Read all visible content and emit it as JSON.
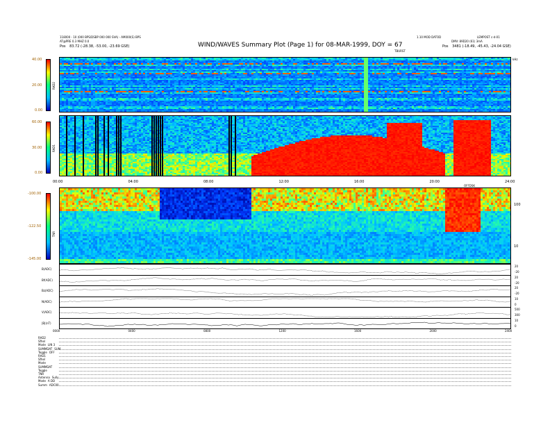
{
  "header": {
    "title": "WIND/WAVES Summary Plot (Page 1) for 08-MAR-1999, DOY = 67",
    "left_line1": "118000 - 10 (000 BPS/DSBP 000 000 SVA) - AM000(S) BPS",
    "left_line2": "AT@PRE 0.3 MHZ 0.0",
    "left_pos_label": "Pos",
    "left_pos": "83.72 (-28.38, -53.00, -23.69 GSE)",
    "right_line1": "1.10 MOD DATOD",
    "right_line2": "LEMPOST c-d-01",
    "right_line3": "DMV: 89D20 (61) 3mA",
    "right_pos_label": "Pos",
    "right_pos": "3481 (-18.49, -45.43, -24.04 GSE)",
    "top_scan_label": "TBURST",
    "top_right_unit": "kHz"
  },
  "panels": {
    "rad2": {
      "name": "RAD2",
      "ticks": [
        "40.00",
        "20.00",
        "0.00"
      ]
    },
    "rad1": {
      "name": "RAD1",
      "ticks": [
        "60.00",
        "30.00",
        "0.00"
      ]
    },
    "tnr": {
      "name": "TNR",
      "ticks": [
        "-100.00",
        "-122.50",
        "-145.00"
      ],
      "right_ticks": [
        "100",
        "10"
      ],
      "flag": "OFFDSK"
    },
    "time_axis": [
      "00:00",
      "04:00",
      "08:00",
      "12:00",
      "16:00",
      "20:00",
      "24:00"
    ],
    "time_axis_small": [
      "0000",
      "0400",
      "0800",
      "1200",
      "1600",
      "2000",
      "2400"
    ],
    "lines": [
      {
        "label": "B(ADC)",
        "right": [
          "20",
          "-20"
        ]
      },
      {
        "label": "Bf(ADC)",
        "right": [
          "20",
          "-20"
        ]
      },
      {
        "label": "Bz(ADC)",
        "right": [
          "20",
          "-20"
        ]
      },
      {
        "label": "N(ADC)",
        "right": [
          "10",
          "0"
        ]
      },
      {
        "label": "V(ADC)",
        "right": [
          "500",
          "300"
        ]
      },
      {
        "label": "|B|(nT)",
        "right": [
          "10",
          "0"
        ]
      }
    ]
  },
  "footer": [
    {
      "label": "RAD2",
      "value": ""
    },
    {
      "label": "Sfhel",
      "value": ""
    },
    {
      "label": "Mode",
      "value": "LIN 3"
    },
    {
      "label": "SUMMDAT",
      "value": "SUM"
    },
    {
      "label": "Toggle",
      "value": "OFF"
    },
    {
      "label": "RAD1",
      "value": ""
    },
    {
      "label": "Sfhel",
      "value": ""
    },
    {
      "label": "Mode",
      "value": ""
    },
    {
      "label": "SUMMDAT",
      "value": ""
    },
    {
      "label": "Toggle",
      "value": ""
    },
    {
      "label": "TNR",
      "value": ""
    },
    {
      "label": "Antenna",
      "value": "Sully"
    },
    {
      "label": "Mode",
      "value": "A DD"
    },
    {
      "label": "Summ",
      "value": "ADC00"
    }
  ],
  "chart_data": {
    "type": "heatmap",
    "title": "WIND/WAVES Summary Plot (Page 1) for 08-MAR-1999, DOY = 67",
    "x": [
      "00:00",
      "04:00",
      "08:00",
      "12:00",
      "16:00",
      "20:00",
      "24:00"
    ],
    "xlim": [
      "00:00",
      "24:00"
    ],
    "series": [
      {
        "name": "RAD2",
        "ylim": [
          0,
          40
        ],
        "colorbar": [
          "40.00",
          "20.00",
          "0.00"
        ]
      },
      {
        "name": "RAD1",
        "ylim": [
          0,
          60
        ],
        "colorbar": [
          "60.00",
          "30.00",
          "0.00"
        ]
      },
      {
        "name": "TNR",
        "ylim": [
          -145,
          -100
        ],
        "colorbar": [
          "-100.00",
          "-122.50",
          "-145.00"
        ]
      }
    ],
    "colors": {
      "high": "#ff0000",
      "mid_high": "#ffff00",
      "mid": "#00ff80",
      "mid_low": "#00c0ff",
      "low": "#0000c0"
    }
  }
}
